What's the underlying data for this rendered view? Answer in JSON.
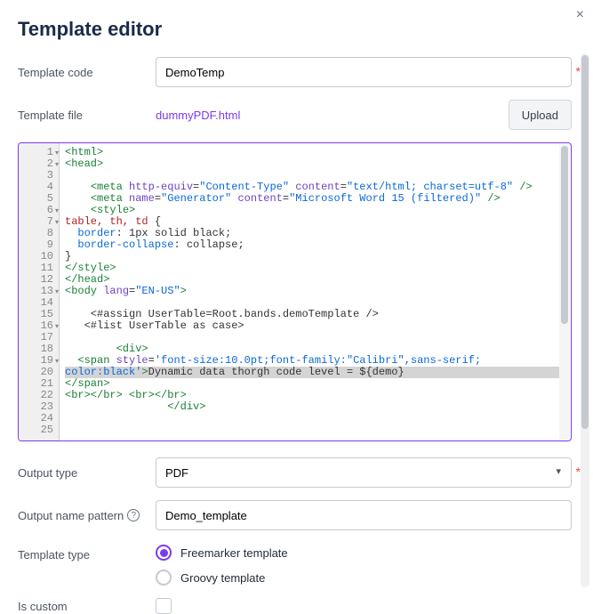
{
  "dialog": {
    "title": "Template editor",
    "close": "×"
  },
  "fields": {
    "template_code_label": "Template code",
    "template_code_value": "DemoTemp",
    "template_file_label": "Template file",
    "template_file_name": "dummyPDF.html",
    "upload_label": "Upload",
    "output_type_label": "Output type",
    "output_type_value": "PDF",
    "output_name_label": "Output name pattern",
    "output_name_value": "Demo_template",
    "template_type_label": "Template type",
    "template_type_options": {
      "freemarker": "Freemarker template",
      "groovy": "Groovy template"
    },
    "template_type_selected": "freemarker",
    "is_custom_label": "Is custom",
    "is_custom_checked": false
  },
  "code_lines": [
    {
      "n": 1,
      "fold": true,
      "html": "<span class='tag'>&lt;html&gt;</span>"
    },
    {
      "n": 2,
      "fold": true,
      "html": "<span class='tag'>&lt;head&gt;</span>"
    },
    {
      "n": 3,
      "html": ""
    },
    {
      "n": 4,
      "html": "    <span class='tag'>&lt;meta</span> <span class='attr'>http-equiv</span>=<span class='str'>\"Content-Type\"</span> <span class='attr'>content</span>=<span class='str'>\"text/html; charset=utf-8\"</span> <span class='tag'>/&gt;</span>"
    },
    {
      "n": 5,
      "html": "    <span class='tag'>&lt;meta</span> <span class='attr'>name</span>=<span class='str'>\"Generator\"</span> <span class='attr'>content</span>=<span class='str'>\"Microsoft Word 15 (filtered)\"</span> <span class='tag'>/&gt;</span>"
    },
    {
      "n": 6,
      "fold": true,
      "html": "    <span class='tag'>&lt;style&gt;</span>"
    },
    {
      "n": 7,
      "fold": true,
      "html": "<span class='kw'>table, th, td</span> {"
    },
    {
      "n": 8,
      "html": "  <span class='prop'>border</span>: <span class='val'>1px solid black</span>;"
    },
    {
      "n": 9,
      "html": "  <span class='prop'>border-collapse</span>: <span class='val'>collapse</span>;"
    },
    {
      "n": 10,
      "html": "}"
    },
    {
      "n": 11,
      "html": "<span class='tag'>&lt;/style&gt;</span>"
    },
    {
      "n": 12,
      "html": "<span class='tag'>&lt;/head&gt;</span>"
    },
    {
      "n": 13,
      "fold": true,
      "html": "<span class='tag'>&lt;body</span> <span class='attr'>lang</span>=<span class='str'>\"EN-US\"</span><span class='tag'>&gt;</span>"
    },
    {
      "n": 14,
      "html": ""
    },
    {
      "n": 15,
      "html": "    &lt;#assign UserTable=Root.bands.demoTemplate /&gt;"
    },
    {
      "n": 16,
      "fold": true,
      "html": "   &lt;#list UserTable as case&gt;"
    },
    {
      "n": 17,
      "html": ""
    },
    {
      "n": 18,
      "html": "        <span class='tag'>&lt;div&gt;</span>"
    },
    {
      "n": 19,
      "fold": true,
      "html": "  <span class='tag'>&lt;span</span> <span class='attr'>style</span>=<span class='str'>'font-size:10.0pt;font-family:\"Calibri\",sans-serif;</span>"
    },
    {
      "n": 20,
      "hl": true,
      "html": "<span class='str'>color:black'</span><span class='tag'>&gt;</span>Dynamic data thorgh code level = ${demo}"
    },
    {
      "n": 21,
      "html": "<span class='tag'>&lt;/span&gt;</span>"
    },
    {
      "n": 22,
      "html": "<span class='tag'>&lt;br&gt;&lt;/br&gt;</span> <span class='tag'>&lt;br&gt;&lt;/br&gt;</span>"
    },
    {
      "n": 23,
      "html": "                <span class='tag'>&lt;/div&gt;</span>"
    },
    {
      "n": 24,
      "html": ""
    },
    {
      "n": 25,
      "html": ""
    }
  ]
}
